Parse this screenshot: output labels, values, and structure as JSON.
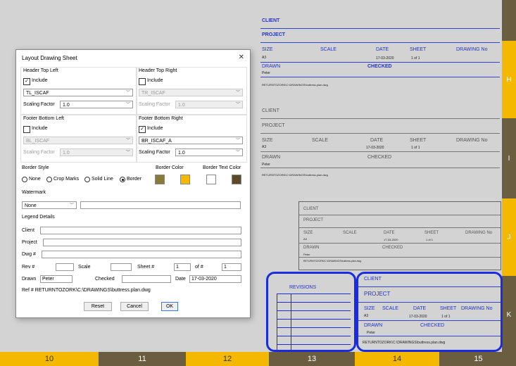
{
  "sheet": {
    "right_labels": [
      "H",
      "I",
      "J",
      "K"
    ],
    "bottom_labels": [
      "10",
      "11",
      "12",
      "13",
      "14",
      "15"
    ],
    "title_block": {
      "client": "CLIENT",
      "project": "PROJECT",
      "size": "SIZE",
      "size_val": "A3",
      "scale": "SCALE",
      "date": "DATE",
      "date_val": "17-03-2020",
      "sheet": "SHEET",
      "sheet_val": "1 of 1",
      "drawing_no": "DRAWING No",
      "drawn": "DRAWN",
      "drawn_val": "Peter",
      "checked": "CHECKED",
      "ref": "RETURNTOZORK\\C:\\DRAWINGS\\buttress.plan.dwg"
    },
    "revisions": "REVISIONS",
    "colors": {
      "blue": "#1a2be0",
      "gold": "#f5b800",
      "brown": "#6b5d40"
    }
  },
  "dialog": {
    "title": "Layout Drawing Sheet",
    "close": "✕",
    "htl": {
      "heading": "Header Top Left",
      "include": "Include",
      "checked": true,
      "value": "TL_ISCAF",
      "scale_label": "Scaling Factor",
      "scale_value": "1.0"
    },
    "htr": {
      "heading": "Header Top Right",
      "include": "Include",
      "checked": false,
      "value": "TR_ISCAF",
      "scale_label": "Scaling Factor",
      "scale_value": "1.0"
    },
    "fbl": {
      "heading": "Footer Bottom Left",
      "include": "Include",
      "checked": false,
      "value": "BL_ISCAF",
      "scale_label": "Scaling Factor",
      "scale_value": "1.0"
    },
    "fbr": {
      "heading": "Footer Bottom Right",
      "include": "Include",
      "checked": true,
      "value": "BR_ISCAF_A",
      "scale_label": "Scaling Factor",
      "scale_value": "1.0"
    },
    "border_style": {
      "heading": "Border Style",
      "options": [
        "None",
        "Crop Marks",
        "Solid Line",
        "Border"
      ],
      "selected": "Border"
    },
    "border_color": {
      "heading": "Border Color",
      "colors": [
        "#8a7a3a",
        "#f5b800"
      ]
    },
    "border_text_color": {
      "heading": "Border Text Color",
      "colors": [
        "#ffffff",
        "#5a4a2a"
      ]
    },
    "watermark": {
      "heading": "Watermark",
      "value": "None",
      "text": ""
    },
    "legend": {
      "heading": "Legend Details",
      "client": "Client",
      "project": "Project",
      "dwg": "Dwg #",
      "rev": "Rev #",
      "scale": "Scale",
      "sheet": "Sheet #",
      "sheet_val": "1",
      "of": "of #",
      "of_val": "1",
      "drawn": "Drawn",
      "drawn_val": "Peter",
      "checked": "Checked",
      "date": "Date",
      "date_val": "17-03-2020",
      "ref": "Ref # RETURNTOZORK\\C:\\DRAWINGS\\buttress.plan.dwg"
    },
    "buttons": {
      "reset": "Reset",
      "cancel": "Cancel",
      "ok": "OK"
    }
  }
}
